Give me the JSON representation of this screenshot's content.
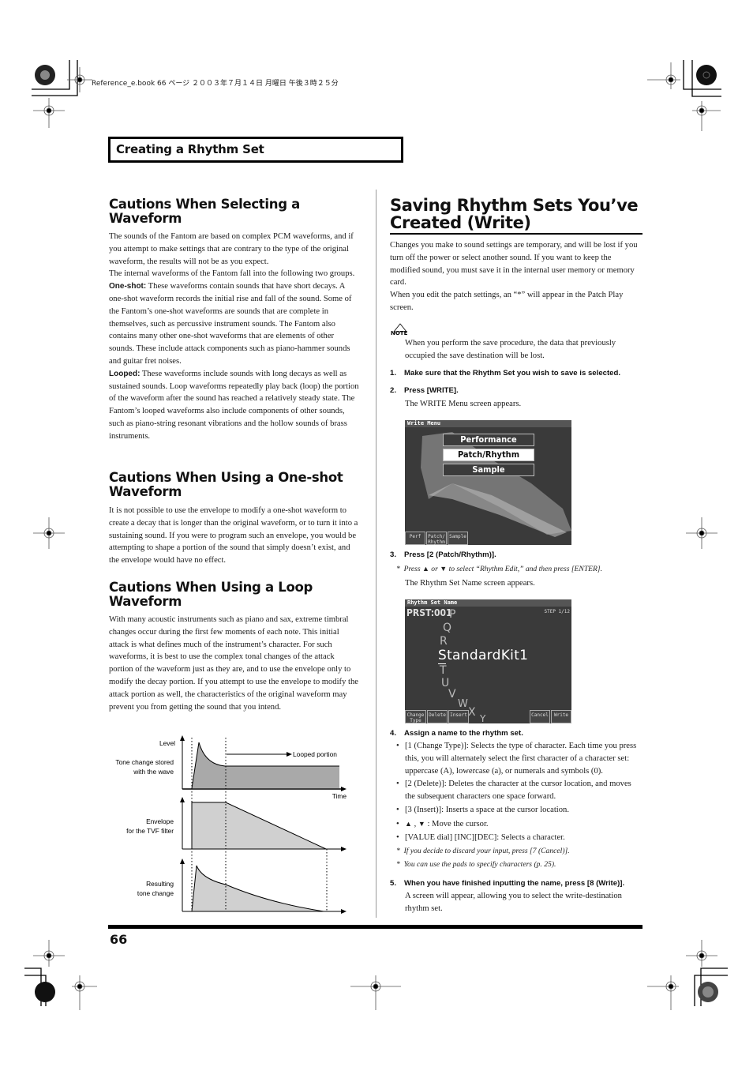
{
  "print_header": "Reference_e.book 66 ページ ２００３年７月１４日 月曜日 午後３時２５分",
  "section_title": "Creating a Rhythm Set",
  "left": {
    "sections": [
      {
        "title_lines": [
          "Cautions When Selecting a",
          "Waveform"
        ],
        "paragraphs": [
          "The sounds of the Fantom are based on complex PCM waveforms, and if you attempt to make settings that are contrary to the type of the original waveform, the results will not be as you expect.",
          "The internal waveforms of the Fantom fall into the following two groups."
        ],
        "terms": [
          {
            "term": "One-shot:",
            "text": " These waveforms contain sounds that have short decays. A one-shot waveform records the initial rise and fall of the sound. Some of the Fantom’s one-shot waveforms are sounds that are complete in themselves, such as percussive instrument sounds. The Fantom also contains many other one-shot waveforms that are elements of other sounds. These include attack components such as piano-hammer sounds and guitar fret noises."
          },
          {
            "term": "Looped:",
            "text": " These waveforms include sounds with long decays as well as sustained sounds. Loop waveforms repeatedly play back (loop) the portion of the waveform after the sound has reached a relatively steady state. The Fantom’s looped waveforms also include components of other sounds, such as piano-string resonant vibrations and the hollow sounds of brass instruments."
          }
        ]
      },
      {
        "title_lines": [
          "Cautions When Using a One-shot",
          "Waveform"
        ],
        "paragraphs": [
          "It is not possible to use the envelope to modify a one-shot waveform to create a decay that is longer than the original waveform, or to turn it into a sustaining sound. If you were to program such an envelope, you would be attempting to shape a portion of the sound that simply doesn’t exist, and the envelope would have no effect."
        ]
      },
      {
        "title_lines": [
          "Cautions When Using a Loop",
          "Waveform"
        ],
        "paragraphs": [
          "With many acoustic instruments such as piano and sax, extreme timbral changes occur during the first few moments of each note. This initial attack is what defines much of the instrument’s character. For such waveforms, it is best to use the complex tonal changes of the attack portion of the waveform just as they are, and to use the envelope only to modify the decay portion. If you attempt to use the envelope to modify the attack portion as well, the characteristics of the original waveform may prevent you from getting the sound that you intend."
        ]
      }
    ],
    "diagram": {
      "level_label": "Level",
      "time_label": "Time",
      "looped_label": "Looped portion",
      "panel1_label": [
        "Tone change stored",
        "with the wave"
      ],
      "panel2_label": [
        "Envelope",
        "for the TVF filter"
      ],
      "panel3_label": [
        "Resulting",
        "tone change"
      ],
      "fill_dark": "#a9a9a9",
      "fill_light": "#d0d0d0"
    }
  },
  "right": {
    "title_lines": [
      "Saving Rhythm Sets You’ve",
      "Created (Write)"
    ],
    "paragraphs": [
      "Changes you make to sound settings are temporary, and will be lost if you turn off the power or select another sound. If you want to keep the modified sound, you must save it in the internal user memory or memory card.",
      "When you edit the patch settings, an “*” will appear in the Patch Play screen."
    ],
    "note_label": "NOTE",
    "note_text": "When you perform the save procedure, the data that previously occupied the save destination will be lost.",
    "steps": [
      {
        "num": "1.",
        "text": "Make sure that the Rhythm Set you wish to save is selected."
      },
      {
        "num": "2.",
        "text": "Press [WRITE].",
        "sub": "The WRITE Menu screen appears."
      },
      {
        "num": "3.",
        "text": "Press [2 (Patch/Rhythm)].",
        "aside_pre": "Press",
        "aside_or": "or",
        "aside_post": "to select “Rhythm Edit,” and then press [ENTER].",
        "sub": "The Rhythm Set Name screen appears."
      },
      {
        "num": "4.",
        "text": "Assign a name to the rhythm set."
      },
      {
        "num": "5.",
        "text": "When you have finished inputting the name, press [8 (Write)].",
        "sub": "A screen will appear, allowing you to select the write-destination rhythm set."
      }
    ],
    "bullets": [
      "[1 (Change Type)]: Selects the type of character. Each time you press this, you will alternately select the first character of a character set: uppercase (A), lowercase (a), or numerals and symbols (0).",
      "[2 (Delete)]: Deletes the character at the cursor location, and moves the subsequent characters one space forward.",
      "[3 (Insert)]: Inserts a space at the cursor location.",
      ": Move the cursor.",
      "[VALUE dial] [INC][DEC]: Selects a character."
    ],
    "asides": [
      "If you decide to discard your input, press [7 (Cancel)].",
      "You can use the pads to specify characters (p. 25)."
    ],
    "write_menu_screen": {
      "title": "Write Menu",
      "items": [
        "Performance",
        "Patch/Rhythm",
        "Sample"
      ],
      "selected": "Patch/Rhythm",
      "fkeys": [
        "Perf",
        "Patch/ Rhythm",
        "Sample"
      ]
    },
    "name_screen": {
      "title": "Rhythm Set Name",
      "preset": "PRST:001",
      "step": "STEP  1/12",
      "name": "StandardKit1",
      "wheel_chars": [
        "P",
        "Q",
        "R",
        "T",
        "U",
        "V",
        "W",
        "X",
        "Y"
      ],
      "fkeys": [
        "Change Type",
        "Delete",
        "Insert",
        "Cancel",
        "Write"
      ]
    }
  },
  "page_number": "66"
}
